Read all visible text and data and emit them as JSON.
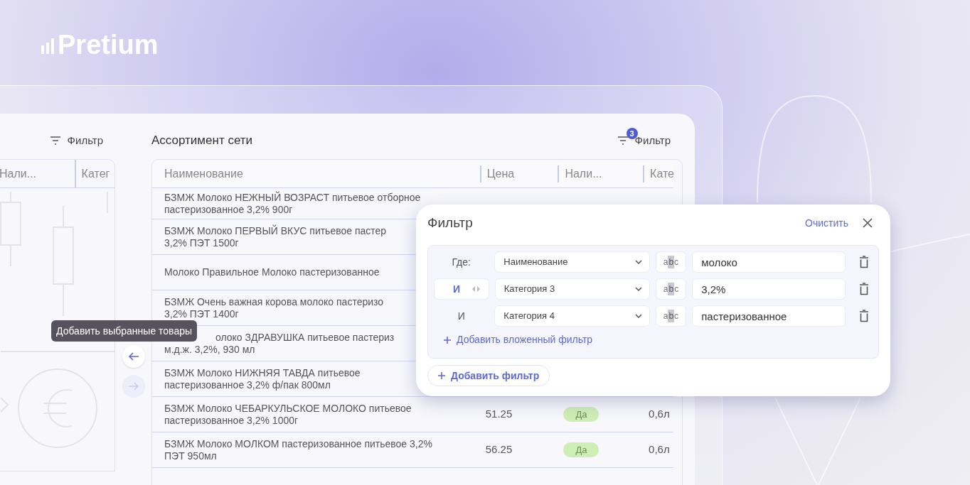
{
  "logo": {
    "text": "Pretium"
  },
  "left_panel": {
    "filter_button": "Фильтр",
    "columns": [
      "Нали...",
      "Катег"
    ]
  },
  "tooltip": "Добавить выбранные товары",
  "transfer_buttons": [
    {
      "kind": "left",
      "disabled": false
    },
    {
      "kind": "right",
      "disabled": true
    }
  ],
  "right_panel": {
    "title": "Ассортимент сети",
    "filter_button": "Фильтр",
    "filter_count": "3",
    "columns": [
      "Наименование",
      "Цена",
      "Нали...",
      "Кате"
    ],
    "rows": [
      {
        "name_lines": [
          "БЗМЖ Молоко НЕЖНЫЙ ВОЗРАСТ питьевое отборное",
          "пастеризованное 3,2% 900г"
        ]
      },
      {
        "name_lines": [
          "БЗМЖ Молоко ПЕРВЫЙ ВКУС питьевое пастер",
          "3,2% ПЭТ 1500г"
        ]
      },
      {
        "name_lines": [
          "Молоко Правильное Молоко пастеризованное"
        ]
      },
      {
        "name_lines": [
          "БЗМЖ Очень важная корова молоко пастеризо",
          "3,2% ПЭТ 1400г"
        ]
      },
      {
        "name_lines": [
          "олоко ЗДРАВУШКА питьевое пастериз",
          "м.д.ж. 3,2%, 930 мл"
        ],
        "covered_start": true
      },
      {
        "name_lines": [
          "БЗМЖ Молоко НИЖНЯЯ ТАВДА питьевое",
          "пастеризованное 3,2% ф/пак 800мл"
        ]
      },
      {
        "name_lines": [
          "БЗМЖ Молоко ЧЕБАРКУЛЬСКОЕ МОЛОКО питьевое",
          "пастеризованное 3,2% 1000г"
        ],
        "price": "51.25",
        "availability": "Да",
        "category": "0,6л"
      },
      {
        "name_lines": [
          "БЗМЖ Молоко МОЛКОМ пастеризованное питьевое 3,2%",
          "ПЭТ 950мл"
        ],
        "price": "56.25",
        "availability": "Да",
        "category": "0,6л"
      }
    ]
  },
  "filter_popup": {
    "title": "Фильтр",
    "clear_button": "Очистить",
    "conditions": [
      {
        "kind": "label",
        "connector": "Где:",
        "field": "Наименование",
        "type_label": "abc",
        "value": "молоко"
      },
      {
        "kind": "toggle",
        "connector": "И",
        "field": "Категория 3",
        "type_label": "abc",
        "value": "3,2%"
      },
      {
        "kind": "label",
        "connector": "И",
        "field": "Категория 4",
        "type_label": "abc",
        "value": "пастеризованное"
      }
    ],
    "add_nested_button": "Добавить вложенный фильтр",
    "add_filter_button": "Добавить фильтр"
  }
}
